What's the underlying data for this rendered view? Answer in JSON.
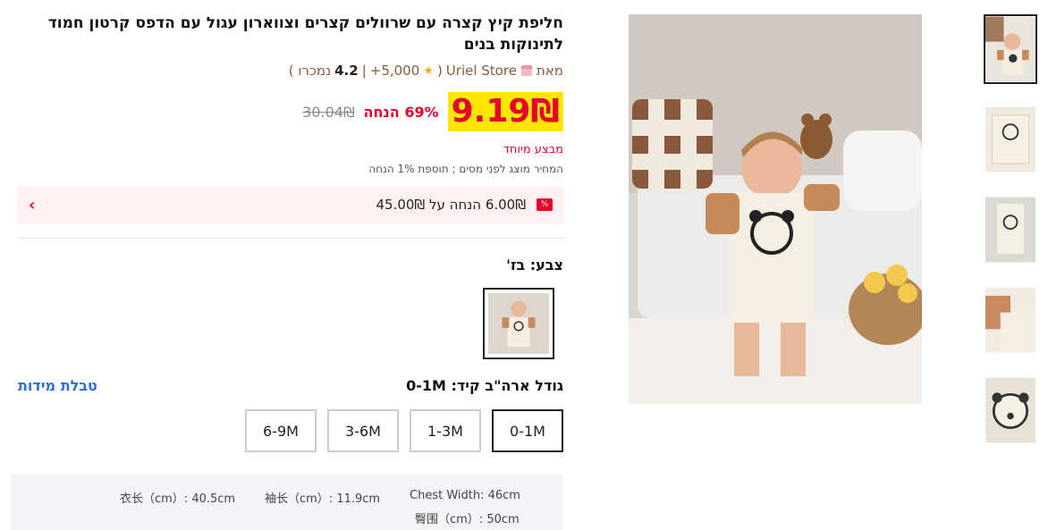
{
  "product": {
    "title": "חליפת קיץ קצרה עם שרוולים קצרים וצווארון עגול עם הדפס קרטון חמוד לתינוקות בנים",
    "by_label": "מאת",
    "store_name": "Uriel Store",
    "rating_open": "(",
    "rating": "4.2",
    "separator": "|",
    "sold_count": "5,000+",
    "sold_label": "נמכרו )",
    "price": "9.19₪",
    "discount": "69% הנחה",
    "old_price": "30.04₪",
    "special_label": "מבצע מיוחד",
    "tax_note": "המחיר מוצג לפני מסים ; תוספת 1% הנחה"
  },
  "coupon": {
    "text": "6.00₪ הנחה על 45.00₪",
    "icon_symbol": "%",
    "chevron": "›"
  },
  "color": {
    "label": "צבע: בז'"
  },
  "size": {
    "label": "גודל ארה\"ב קיד: 0-1M",
    "chart_link": "טבלת מידות",
    "options": [
      "0-1M",
      "1-3M",
      "3-6M",
      "6-9M"
    ],
    "selected": "0-1M"
  },
  "measurements": {
    "length": "衣长（cm）: 40.5cm",
    "sleeve": "袖长（cm）: 11.9cm",
    "chest": "Chest Width: 46cm",
    "hip": "臀围（cm）: 50cm"
  },
  "colors": {
    "accent_red": "#e4002b",
    "price_highlight": "#ffe600",
    "link_blue": "#2f6fdb",
    "store_brown": "#8a5a3c"
  },
  "icons": [
    "star-icon",
    "store-icon",
    "coupon-icon",
    "chevron-left-icon"
  ]
}
